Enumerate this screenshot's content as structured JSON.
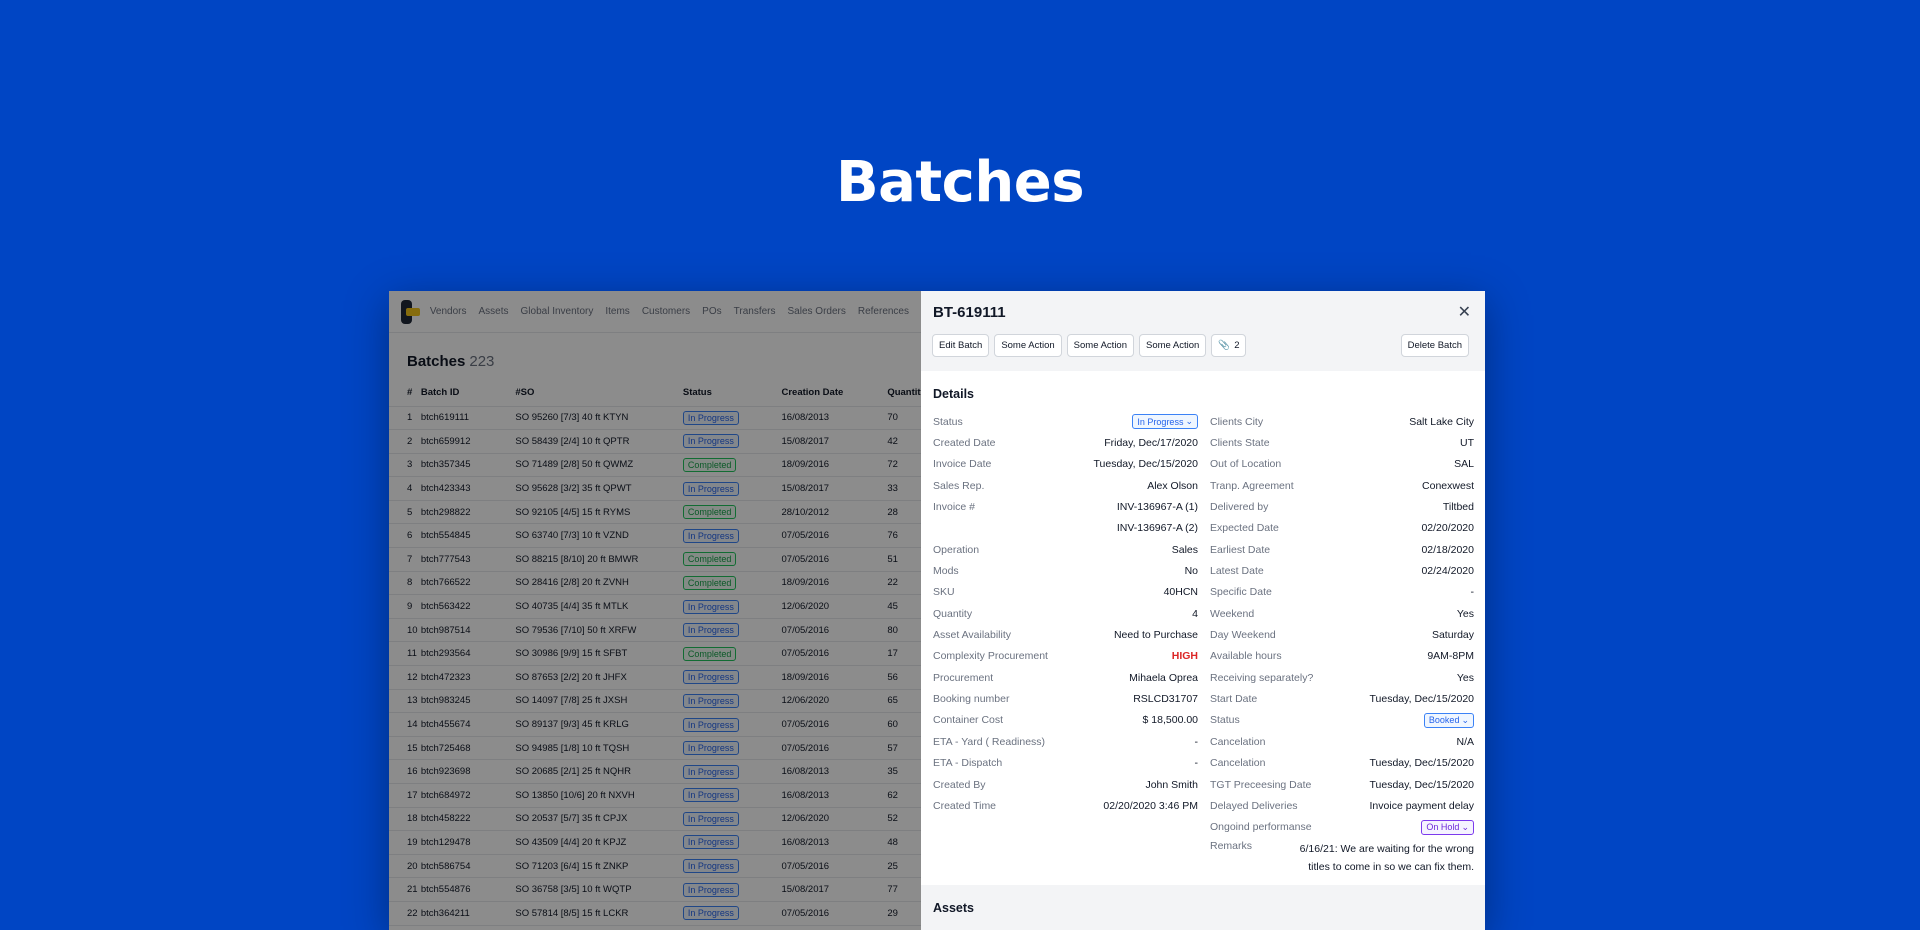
{
  "hero": {
    "title": "Batches"
  },
  "nav": [
    "Vendors",
    "Assets",
    "Global Inventory",
    "Items",
    "Customers",
    "POs",
    "Transfers",
    "Sales Orders",
    "References"
  ],
  "list": {
    "title": "Batches",
    "count": "223",
    "columns": [
      "#",
      "Batch ID",
      "#SO",
      "Status",
      "Creation Date",
      "Quantity"
    ],
    "rows": [
      [
        "1",
        "btch619111",
        "SO 95260 [7/3] 40 ft KTYN",
        "In Progress",
        "16/08/2013",
        "70"
      ],
      [
        "2",
        "btch659912",
        "SO 58439 [2/4] 10 ft QPTR",
        "In Progress",
        "15/08/2017",
        "42"
      ],
      [
        "3",
        "btch357345",
        "SO 71489 [2/8] 50 ft QWMZ",
        "Completed",
        "18/09/2016",
        "72"
      ],
      [
        "4",
        "btch423343",
        "SO 95628 [3/2] 35 ft QPWT",
        "In Progress",
        "15/08/2017",
        "33"
      ],
      [
        "5",
        "btch298822",
        "SO 92105 [4/5] 15 ft RYMS",
        "Completed",
        "28/10/2012",
        "28"
      ],
      [
        "6",
        "btch554845",
        "SO 63740 [7/3] 10 ft VZND",
        "In Progress",
        "07/05/2016",
        "76"
      ],
      [
        "7",
        "btch777543",
        "SO 88215 [8/10] 20 ft BMWR",
        "Completed",
        "07/05/2016",
        "51"
      ],
      [
        "8",
        "btch766522",
        "SO 28416 [2/8] 20 ft ZVNH",
        "Completed",
        "18/09/2016",
        "22"
      ],
      [
        "9",
        "btch563422",
        "SO 40735 [4/4] 35 ft MTLK",
        "In Progress",
        "12/06/2020",
        "45"
      ],
      [
        "10",
        "btch987514",
        "SO 79536 [7/10] 50 ft XRFW",
        "In Progress",
        "07/05/2016",
        "80"
      ],
      [
        "11",
        "btch293564",
        "SO 30986 [9/9] 15 ft SFBT",
        "Completed",
        "07/05/2016",
        "17"
      ],
      [
        "12",
        "btch472323",
        "SO 87653 [2/2] 20 ft JHFX",
        "In Progress",
        "18/09/2016",
        "56"
      ],
      [
        "13",
        "btch983245",
        "SO 14097 [7/8] 25 ft JXSH",
        "In Progress",
        "12/06/2020",
        "65"
      ],
      [
        "14",
        "btch455674",
        "SO 89137 [9/3] 45 ft KRLG",
        "In Progress",
        "07/05/2016",
        "60"
      ],
      [
        "15",
        "btch725468",
        "SO 94985 [1/8] 10 ft TQSH",
        "In Progress",
        "07/05/2016",
        "57"
      ],
      [
        "16",
        "btch923698",
        "SO 20685 [2/1] 25 ft NQHR",
        "In Progress",
        "16/08/2013",
        "35"
      ],
      [
        "17",
        "btch684972",
        "SO 13850 [10/6] 20 ft NXVH",
        "In Progress",
        "16/08/2013",
        "62"
      ],
      [
        "18",
        "btch458222",
        "SO 20537 [5/7] 35 ft CPJX",
        "In Progress",
        "12/06/2020",
        "52"
      ],
      [
        "19",
        "btch129478",
        "SO 43509 [4/4] 20 ft KPJZ",
        "In Progress",
        "16/08/2013",
        "48"
      ],
      [
        "20",
        "btch586754",
        "SO 71203 [6/4] 15 ft ZNKP",
        "In Progress",
        "07/05/2016",
        "25"
      ],
      [
        "21",
        "btch554876",
        "SO 36758 [3/5] 10 ft WQTP",
        "In Progress",
        "15/08/2017",
        "77"
      ],
      [
        "22",
        "btch364211",
        "SO 57814 [8/5] 15 ft LCKR",
        "In Progress",
        "07/05/2016",
        "29"
      ]
    ]
  },
  "panel": {
    "title": "BT-619111",
    "actions": [
      "Edit Batch",
      "Some Action",
      "Some Action",
      "Some Action"
    ],
    "attachments": "2",
    "delete": "Delete Batch",
    "section": "Details",
    "left": [
      {
        "label": "Status",
        "value": "In Progress",
        "kind": "badge"
      },
      {
        "label": "Created Date",
        "value": "Friday, Dec/17/2020"
      },
      {
        "label": "Invoice Date",
        "value": "Tuesday, Dec/15/2020"
      },
      {
        "label": "Sales Rep.",
        "value": "Alex Olson"
      },
      {
        "label": "Invoice #",
        "value": "INV-136967-A (1)"
      },
      {
        "label": "",
        "value": "INV-136967-A (2)"
      },
      {
        "label": "Operation",
        "value": "Sales"
      },
      {
        "label": "Mods",
        "value": "No"
      },
      {
        "label": "SKU",
        "value": "40HCN"
      },
      {
        "label": "Quantity",
        "value": "4"
      },
      {
        "label": "Asset Availability",
        "value": "Need to Purchase"
      },
      {
        "label": "Complexity Procurement",
        "value": "HIGH",
        "kind": "high"
      },
      {
        "label": "Procurement",
        "value": "Mihaela Oprea"
      },
      {
        "label": "Booking number",
        "value": "RSLCD31707"
      },
      {
        "label": "Container Cost",
        "value": "$ 18,500.00"
      },
      {
        "label": "ETA - Yard ( Readiness)",
        "value": "-"
      },
      {
        "label": "ETA - Dispatch",
        "value": "-"
      },
      {
        "label": "Created By",
        "value": "John Smith"
      },
      {
        "label": "Created Time",
        "value": "02/20/2020 3:46 PM"
      }
    ],
    "right": [
      {
        "label": "Clients City",
        "value": "Salt Lake City"
      },
      {
        "label": "Clients State",
        "value": "UT"
      },
      {
        "label": "Out of Location",
        "value": "SAL"
      },
      {
        "label": "Tranp. Agreement",
        "value": "Conexwest"
      },
      {
        "label": "Delivered by",
        "value": "Tiltbed"
      },
      {
        "label": "Expected Date",
        "value": "02/20/2020"
      },
      {
        "label": "Earliest Date",
        "value": "02/18/2020"
      },
      {
        "label": "Latest Date",
        "value": "02/24/2020"
      },
      {
        "label": "Specific Date",
        "value": "-"
      },
      {
        "label": "Weekend",
        "value": "Yes"
      },
      {
        "label": "Day Weekend",
        "value": "Saturday"
      },
      {
        "label": "Available hours",
        "value": "9AM-8PM"
      },
      {
        "label": "Receiving separately?",
        "value": "Yes"
      },
      {
        "label": "Start Date",
        "value": "Tuesday, Dec/15/2020"
      },
      {
        "label": "Status",
        "value": "Booked",
        "kind": "badge"
      },
      {
        "label": "Cancelation",
        "value": "N/A"
      },
      {
        "label": "Cancelation",
        "value": "Tuesday, Dec/15/2020"
      },
      {
        "label": "TGT Preceesing Date",
        "value": "Tuesday, Dec/15/2020"
      },
      {
        "label": "Delayed Deliveries",
        "value": "Invoice payment delay"
      },
      {
        "label": "Ongoind performanse",
        "value": "On Hold",
        "kind": "badge-violet"
      }
    ],
    "remarks": {
      "label": "Remarks",
      "value": "6/16/21: We are waiting for the wrong titles to come in so we can fix them."
    },
    "assets_title": "Assets"
  }
}
